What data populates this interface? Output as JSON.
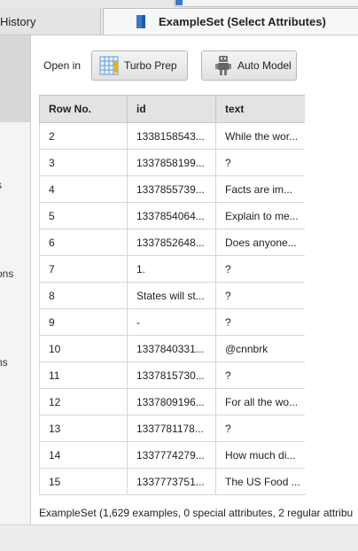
{
  "tabs": {
    "history_label": "History",
    "active_label": "ExampleSet (Select Attributes)"
  },
  "left_panel": {
    "items": [
      "s",
      "ons",
      "ns"
    ]
  },
  "toolbar": {
    "open_in_label": "Open in",
    "turbo_prep_label": "Turbo Prep",
    "auto_model_label": "Auto Model"
  },
  "table": {
    "columns": [
      "Row No.",
      "id",
      "text"
    ],
    "rows": [
      [
        "2",
        "1338158543...",
        "While the wor..."
      ],
      [
        "3",
        "1337858199...",
        "?"
      ],
      [
        "4",
        "1337855739...",
        "Facts are im..."
      ],
      [
        "5",
        "1337854064...",
        "Explain to me..."
      ],
      [
        "6",
        "1337852648...",
        "Does anyone..."
      ],
      [
        "7",
        "1.",
        "?"
      ],
      [
        "8",
        "States will st...",
        "?"
      ],
      [
        "9",
        "-",
        "?"
      ],
      [
        "10",
        "1337840331...",
        "@cnnbrk"
      ],
      [
        "11",
        "1337815730...",
        "?"
      ],
      [
        "12",
        "1337809196...",
        "For all the wo..."
      ],
      [
        "13",
        "1337781178...",
        "?"
      ],
      [
        "14",
        "1337774279...",
        "How much di..."
      ],
      [
        "15",
        "1337773751...",
        "The US Food ..."
      ]
    ]
  },
  "footer": {
    "summary": "ExampleSet (1,629 examples, 0 special attributes, 2 regular attribu"
  },
  "colors": {
    "accent_blue": "#3a78c8",
    "turbo_grid": "#5b9bd5",
    "turbo_figure": "#f0b400"
  },
  "icons": {
    "document": "document-icon",
    "turbo_prep": "turbo-prep-icon",
    "auto_model": "robot-icon"
  }
}
